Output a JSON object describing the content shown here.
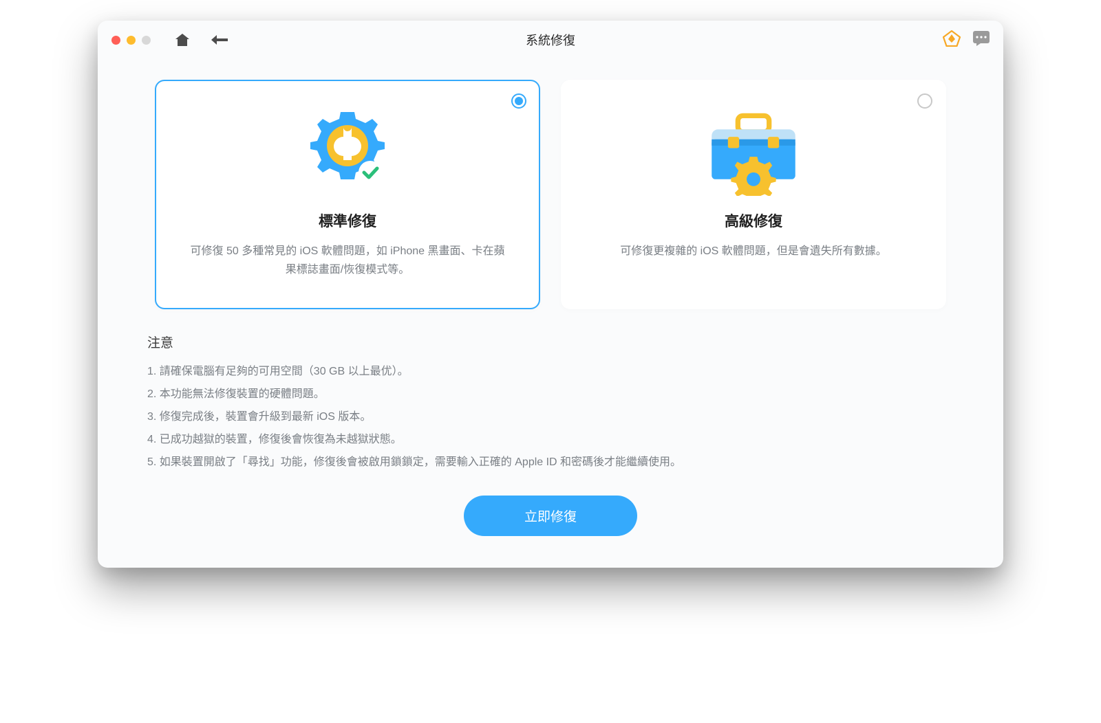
{
  "window": {
    "title": "系統修復"
  },
  "options": {
    "standard": {
      "title": "標準修復",
      "desc": "可修復 50 多種常見的 iOS 軟體問題，如 iPhone 黑畫面、卡在蘋果標誌畫面/恢復模式等。"
    },
    "advanced": {
      "title": "高級修復",
      "desc": "可修復更複雜的 iOS 軟體問題，但是會遺失所有數據。"
    }
  },
  "notes": {
    "title": "注意",
    "items": [
      "請確保電腦有足夠的可用空間（30 GB 以上最优）。",
      "本功能無法修復裝置的硬體問題。",
      "修復完成後，裝置會升級到最新 iOS 版本。",
      "已成功越獄的裝置，修復後會恢復為未越獄狀態。",
      "如果裝置開啟了「尋找」功能，修復後會被啟用鎖鎖定，需要輸入正確的 Apple ID 和密碼後才能繼續使用。"
    ]
  },
  "action": {
    "primary": "立即修復"
  }
}
